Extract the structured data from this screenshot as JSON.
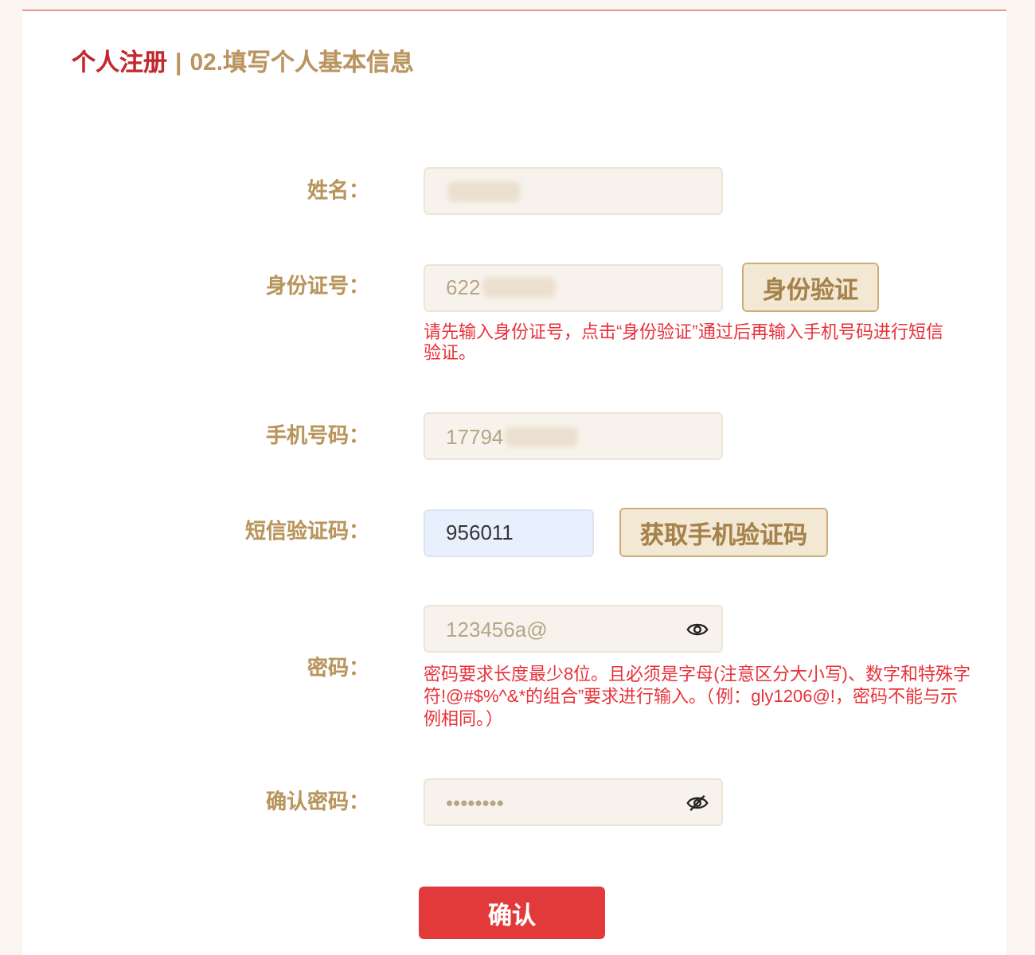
{
  "header": {
    "title": "个人注册",
    "separator": "|",
    "subtitle": "02.填写个人基本信息"
  },
  "form": {
    "rows": [
      {
        "kind": "text",
        "label": "姓名：",
        "redacted": true,
        "autofilled": false
      },
      {
        "kind": "text",
        "label": "身份证号：",
        "value": "622",
        "redacted": true,
        "autofilled": false,
        "button": "身份验证",
        "hint": "请先输入身份证号，点击“身份验证”通过后再输入手机号码进行短信验证。"
      },
      {
        "kind": "text",
        "label": "手机号码：",
        "value": "17794",
        "redacted": true,
        "autofilled": false
      },
      {
        "kind": "code",
        "label": "短信验证码：",
        "value": "956011",
        "redacted": false,
        "autofilled": true,
        "button": "获取手机验证码"
      },
      {
        "kind": "password",
        "label": "密码：",
        "value": "123456a@",
        "redacted": false,
        "autofilled": false,
        "visible": true,
        "hint": "密码要求长度最少8位。且必须是字母(注意区分大小写)、数字和特殊字符!@#$%^&*的组合”要求进行输入。（例：gly1206@!，密码不能与示例相同。）"
      },
      {
        "kind": "password",
        "label": "确认密码：",
        "value": "••••••••",
        "redacted": false,
        "autofilled": false,
        "visible": false
      }
    ]
  },
  "submit": {
    "label": "确认"
  }
}
